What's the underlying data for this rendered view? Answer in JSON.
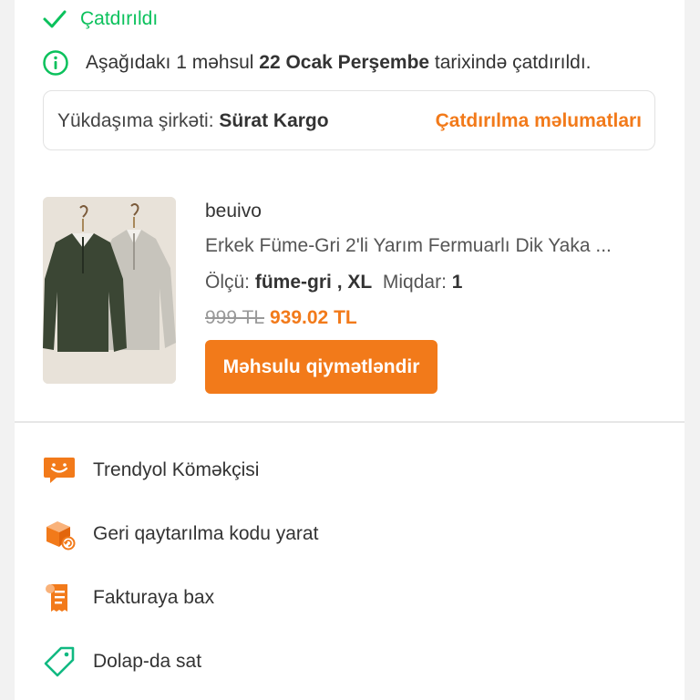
{
  "status": {
    "label": "Çatdırıldı",
    "icon": "check-icon",
    "color": "#0bc15c"
  },
  "info": {
    "icon": "info-icon",
    "prefix": "Aşağıdakı 1 məhsul ",
    "date": "22 Ocak Perşembe",
    "suffix": " tarixində çatdırıldı."
  },
  "cargo": {
    "label": "Yükdaşıma şirkəti: ",
    "company": "Sürat Kargo",
    "link": "Çatdırılma məlumatları"
  },
  "product": {
    "brand": "beuivo",
    "name": "Erkek Füme-Gri 2'li Yarım Fermuarlı Dik Yaka ...",
    "size_label": "Ölçü: ",
    "size_value": "füme-gri , XL",
    "qty_label": "Miqdar: ",
    "qty_value": "1",
    "old_price": "999 TL",
    "new_price": "939.02 TL",
    "rate_button": "Məhsulu qiymətləndir"
  },
  "actions": [
    {
      "icon": "chat-assistant-icon",
      "label": "Trendyol Köməkçisi"
    },
    {
      "icon": "return-box-icon",
      "label": "Geri qaytarılma kodu yarat"
    },
    {
      "icon": "invoice-icon",
      "label": "Fakturaya bax"
    },
    {
      "icon": "price-tag-icon",
      "label": "Dolap-da sat"
    }
  ],
  "colors": {
    "accent": "#f27a1a",
    "success": "#0bc15c"
  }
}
